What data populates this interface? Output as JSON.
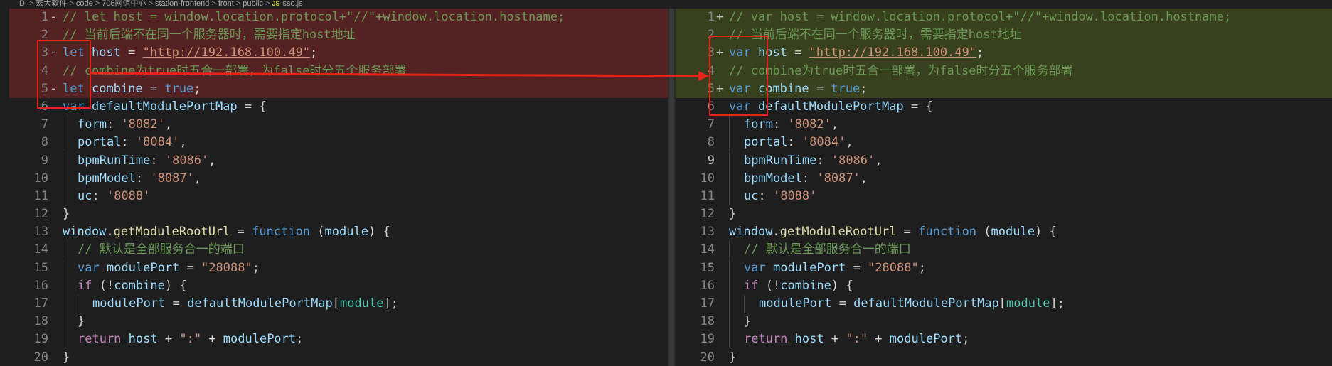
{
  "breadcrumb": [
    "D:",
    "宏大软件",
    "code",
    "706网信中心",
    "station-frontend",
    "front",
    "public",
    "sso.js"
  ],
  "file_icon": "JS",
  "colors": {
    "annotation": "#e8231a",
    "removed_bg": "#6a2a2a",
    "added_bg": "#4b5520"
  },
  "left": [
    {
      "n": "1",
      "m": "-",
      "s": "removed",
      "t": [
        [
          "c-comment",
          "// let host = window.location.protocol+\"//\"+window.location.hostname;"
        ]
      ]
    },
    {
      "n": "2",
      "m": "",
      "s": "removed",
      "t": [
        [
          "c-comment",
          "// 当前后端不在同一个服务器时，需要指定host地址"
        ]
      ]
    },
    {
      "n": "3",
      "m": "-",
      "s": "removed",
      "t": [
        [
          "c-kw",
          "let"
        ],
        [
          "c-plain",
          " "
        ],
        [
          "c-var",
          "host"
        ],
        [
          "c-plain",
          " = "
        ],
        [
          "c-url",
          "\"http://192.168.100.49\""
        ],
        [
          "c-plain",
          ";"
        ]
      ]
    },
    {
      "n": "4",
      "m": "",
      "s": "removed",
      "t": [
        [
          "c-comment",
          "// combine为true时五合一部署，为false时分五个服务部署"
        ]
      ]
    },
    {
      "n": "5",
      "m": "-",
      "s": "removed",
      "t": [
        [
          "c-kw",
          "let"
        ],
        [
          "c-plain",
          " "
        ],
        [
          "c-var",
          "combine"
        ],
        [
          "c-plain",
          " = "
        ],
        [
          "c-kw",
          "true"
        ],
        [
          "c-plain",
          ";"
        ]
      ]
    },
    {
      "n": "6",
      "m": "",
      "s": "",
      "t": [
        [
          "c-kw",
          "var"
        ],
        [
          "c-plain",
          " "
        ],
        [
          "c-var",
          "defaultModulePortMap"
        ],
        [
          "c-plain",
          " = {"
        ]
      ]
    },
    {
      "n": "7",
      "m": "",
      "s": "",
      "g": 1,
      "t": [
        [
          "c-var",
          "form"
        ],
        [
          "c-plain",
          ": "
        ],
        [
          "c-str",
          "'8082'"
        ],
        [
          "c-plain",
          ","
        ]
      ]
    },
    {
      "n": "8",
      "m": "",
      "s": "",
      "g": 1,
      "t": [
        [
          "c-var",
          "portal"
        ],
        [
          "c-plain",
          ": "
        ],
        [
          "c-str",
          "'8084'"
        ],
        [
          "c-plain",
          ","
        ]
      ]
    },
    {
      "n": "9",
      "m": "",
      "s": "",
      "g": 1,
      "t": [
        [
          "c-var",
          "bpmRunTime"
        ],
        [
          "c-plain",
          ": "
        ],
        [
          "c-str",
          "'8086'"
        ],
        [
          "c-plain",
          ","
        ]
      ]
    },
    {
      "n": "10",
      "m": "",
      "s": "",
      "g": 1,
      "t": [
        [
          "c-var",
          "bpmModel"
        ],
        [
          "c-plain",
          ": "
        ],
        [
          "c-str",
          "'8087'"
        ],
        [
          "c-plain",
          ","
        ]
      ]
    },
    {
      "n": "11",
      "m": "",
      "s": "",
      "g": 1,
      "t": [
        [
          "c-var",
          "uc"
        ],
        [
          "c-plain",
          ": "
        ],
        [
          "c-str",
          "'8088'"
        ]
      ]
    },
    {
      "n": "12",
      "m": "",
      "s": "",
      "t": [
        [
          "c-plain",
          "}"
        ]
      ]
    },
    {
      "n": "13",
      "m": "",
      "s": "",
      "t": [
        [
          "c-var",
          "window"
        ],
        [
          "c-plain",
          "."
        ],
        [
          "c-fn",
          "getModuleRootUrl"
        ],
        [
          "c-plain",
          " = "
        ],
        [
          "c-kw",
          "function"
        ],
        [
          "c-plain",
          " ("
        ],
        [
          "c-var",
          "module"
        ],
        [
          "c-plain",
          ") {"
        ]
      ]
    },
    {
      "n": "14",
      "m": "",
      "s": "",
      "g": 1,
      "t": [
        [
          "c-comment",
          "// 默认是全部服务合一的端口"
        ]
      ]
    },
    {
      "n": "15",
      "m": "",
      "s": "",
      "g": 1,
      "t": [
        [
          "c-kw",
          "var"
        ],
        [
          "c-plain",
          " "
        ],
        [
          "c-var",
          "modulePort"
        ],
        [
          "c-plain",
          " = "
        ],
        [
          "c-str",
          "\"28088\""
        ],
        [
          "c-plain",
          ";"
        ]
      ]
    },
    {
      "n": "16",
      "m": "",
      "s": "",
      "g": 1,
      "t": [
        [
          "c-ctrl",
          "if"
        ],
        [
          "c-plain",
          " (!"
        ],
        [
          "c-var",
          "combine"
        ],
        [
          "c-plain",
          ") {"
        ]
      ]
    },
    {
      "n": "17",
      "m": "",
      "s": "",
      "g": 2,
      "t": [
        [
          "c-var",
          "modulePort"
        ],
        [
          "c-plain",
          " = "
        ],
        [
          "c-var",
          "defaultModulePortMap"
        ],
        [
          "c-plain",
          "["
        ],
        [
          "c-cls",
          "module"
        ],
        [
          "c-plain",
          "];"
        ]
      ]
    },
    {
      "n": "18",
      "m": "",
      "s": "",
      "g": 1,
      "t": [
        [
          "c-plain",
          "}"
        ]
      ]
    },
    {
      "n": "19",
      "m": "",
      "s": "",
      "g": 1,
      "t": [
        [
          "c-ctrl",
          "return"
        ],
        [
          "c-plain",
          " "
        ],
        [
          "c-var",
          "host"
        ],
        [
          "c-plain",
          " + "
        ],
        [
          "c-str",
          "\":\""
        ],
        [
          "c-plain",
          " + "
        ],
        [
          "c-var",
          "modulePort"
        ],
        [
          "c-plain",
          ";"
        ]
      ]
    },
    {
      "n": "20",
      "m": "",
      "s": "",
      "t": [
        [
          "c-plain",
          "}"
        ]
      ]
    }
  ],
  "right": [
    {
      "n": "1",
      "m": "+",
      "s": "added",
      "t": [
        [
          "c-comment",
          "// var host = window.location.protocol+\"//\"+window.location.hostname;"
        ]
      ]
    },
    {
      "n": "2",
      "m": "",
      "s": "added",
      "t": [
        [
          "c-comment",
          "// 当前后端不在同一个服务器时，需要指定host地址"
        ]
      ]
    },
    {
      "n": "3",
      "m": "+",
      "s": "added",
      "t": [
        [
          "c-kw",
          "var"
        ],
        [
          "c-plain",
          " "
        ],
        [
          "c-var",
          "host"
        ],
        [
          "c-plain",
          " = "
        ],
        [
          "c-url",
          "\"http://192.168.100.49\""
        ],
        [
          "c-plain",
          ";"
        ]
      ]
    },
    {
      "n": "4",
      "m": "",
      "s": "added",
      "t": [
        [
          "c-comment",
          "// combine为true时五合一部署，为false时分五个服务部署"
        ]
      ]
    },
    {
      "n": "5",
      "m": "+",
      "s": "added",
      "t": [
        [
          "c-kw",
          "var"
        ],
        [
          "c-plain",
          " "
        ],
        [
          "c-var",
          "combine"
        ],
        [
          "c-plain",
          " = "
        ],
        [
          "c-kw",
          "true"
        ],
        [
          "c-plain",
          ";"
        ]
      ]
    },
    {
      "n": "6",
      "m": "",
      "s": "",
      "t": [
        [
          "c-kw",
          "var"
        ],
        [
          "c-plain",
          " "
        ],
        [
          "c-var",
          "defaultModulePortMap"
        ],
        [
          "c-plain",
          " = {"
        ]
      ]
    },
    {
      "n": "7",
      "m": "",
      "s": "",
      "g": 1,
      "t": [
        [
          "c-var",
          "form"
        ],
        [
          "c-plain",
          ": "
        ],
        [
          "c-str",
          "'8082'"
        ],
        [
          "c-plain",
          ","
        ]
      ]
    },
    {
      "n": "8",
      "m": "",
      "s": "",
      "g": 1,
      "t": [
        [
          "c-var",
          "portal"
        ],
        [
          "c-plain",
          ": "
        ],
        [
          "c-str",
          "'8084'"
        ],
        [
          "c-plain",
          ","
        ]
      ]
    },
    {
      "n": "9",
      "m": "",
      "s": "active",
      "g": 1,
      "t": [
        [
          "c-var",
          "bpmRunTime"
        ],
        [
          "c-plain",
          ": "
        ],
        [
          "c-str",
          "'8086'"
        ],
        [
          "c-plain",
          ","
        ]
      ]
    },
    {
      "n": "10",
      "m": "",
      "s": "",
      "g": 1,
      "t": [
        [
          "c-var",
          "bpmModel"
        ],
        [
          "c-plain",
          ": "
        ],
        [
          "c-str",
          "'8087'"
        ],
        [
          "c-plain",
          ","
        ]
      ]
    },
    {
      "n": "11",
      "m": "",
      "s": "",
      "g": 1,
      "t": [
        [
          "c-var",
          "uc"
        ],
        [
          "c-plain",
          ": "
        ],
        [
          "c-str",
          "'8088'"
        ]
      ]
    },
    {
      "n": "12",
      "m": "",
      "s": "",
      "t": [
        [
          "c-plain",
          "}"
        ]
      ]
    },
    {
      "n": "13",
      "m": "",
      "s": "",
      "t": [
        [
          "c-var",
          "window"
        ],
        [
          "c-plain",
          "."
        ],
        [
          "c-fn",
          "getModuleRootUrl"
        ],
        [
          "c-plain",
          " = "
        ],
        [
          "c-kw",
          "function"
        ],
        [
          "c-plain",
          " ("
        ],
        [
          "c-var",
          "module"
        ],
        [
          "c-plain",
          ") {"
        ]
      ]
    },
    {
      "n": "14",
      "m": "",
      "s": "",
      "g": 1,
      "t": [
        [
          "c-comment",
          "// 默认是全部服务合一的端口"
        ]
      ]
    },
    {
      "n": "15",
      "m": "",
      "s": "",
      "g": 1,
      "t": [
        [
          "c-kw",
          "var"
        ],
        [
          "c-plain",
          " "
        ],
        [
          "c-var",
          "modulePort"
        ],
        [
          "c-plain",
          " = "
        ],
        [
          "c-str",
          "\"28088\""
        ],
        [
          "c-plain",
          ";"
        ]
      ]
    },
    {
      "n": "16",
      "m": "",
      "s": "",
      "g": 1,
      "t": [
        [
          "c-ctrl",
          "if"
        ],
        [
          "c-plain",
          " (!"
        ],
        [
          "c-var",
          "combine"
        ],
        [
          "c-plain",
          ") {"
        ]
      ]
    },
    {
      "n": "17",
      "m": "",
      "s": "",
      "g": 2,
      "t": [
        [
          "c-var",
          "modulePort"
        ],
        [
          "c-plain",
          " = "
        ],
        [
          "c-var",
          "defaultModulePortMap"
        ],
        [
          "c-plain",
          "["
        ],
        [
          "c-cls",
          "module"
        ],
        [
          "c-plain",
          "];"
        ]
      ]
    },
    {
      "n": "18",
      "m": "",
      "s": "",
      "g": 1,
      "t": [
        [
          "c-plain",
          "}"
        ]
      ]
    },
    {
      "n": "19",
      "m": "",
      "s": "",
      "g": 1,
      "t": [
        [
          "c-ctrl",
          "return"
        ],
        [
          "c-plain",
          " "
        ],
        [
          "c-var",
          "host"
        ],
        [
          "c-plain",
          " + "
        ],
        [
          "c-str",
          "\":\""
        ],
        [
          "c-plain",
          " + "
        ],
        [
          "c-var",
          "modulePort"
        ],
        [
          "c-plain",
          ";"
        ]
      ]
    },
    {
      "n": "20",
      "m": "",
      "s": "",
      "t": [
        [
          "c-plain",
          "}"
        ]
      ]
    }
  ]
}
